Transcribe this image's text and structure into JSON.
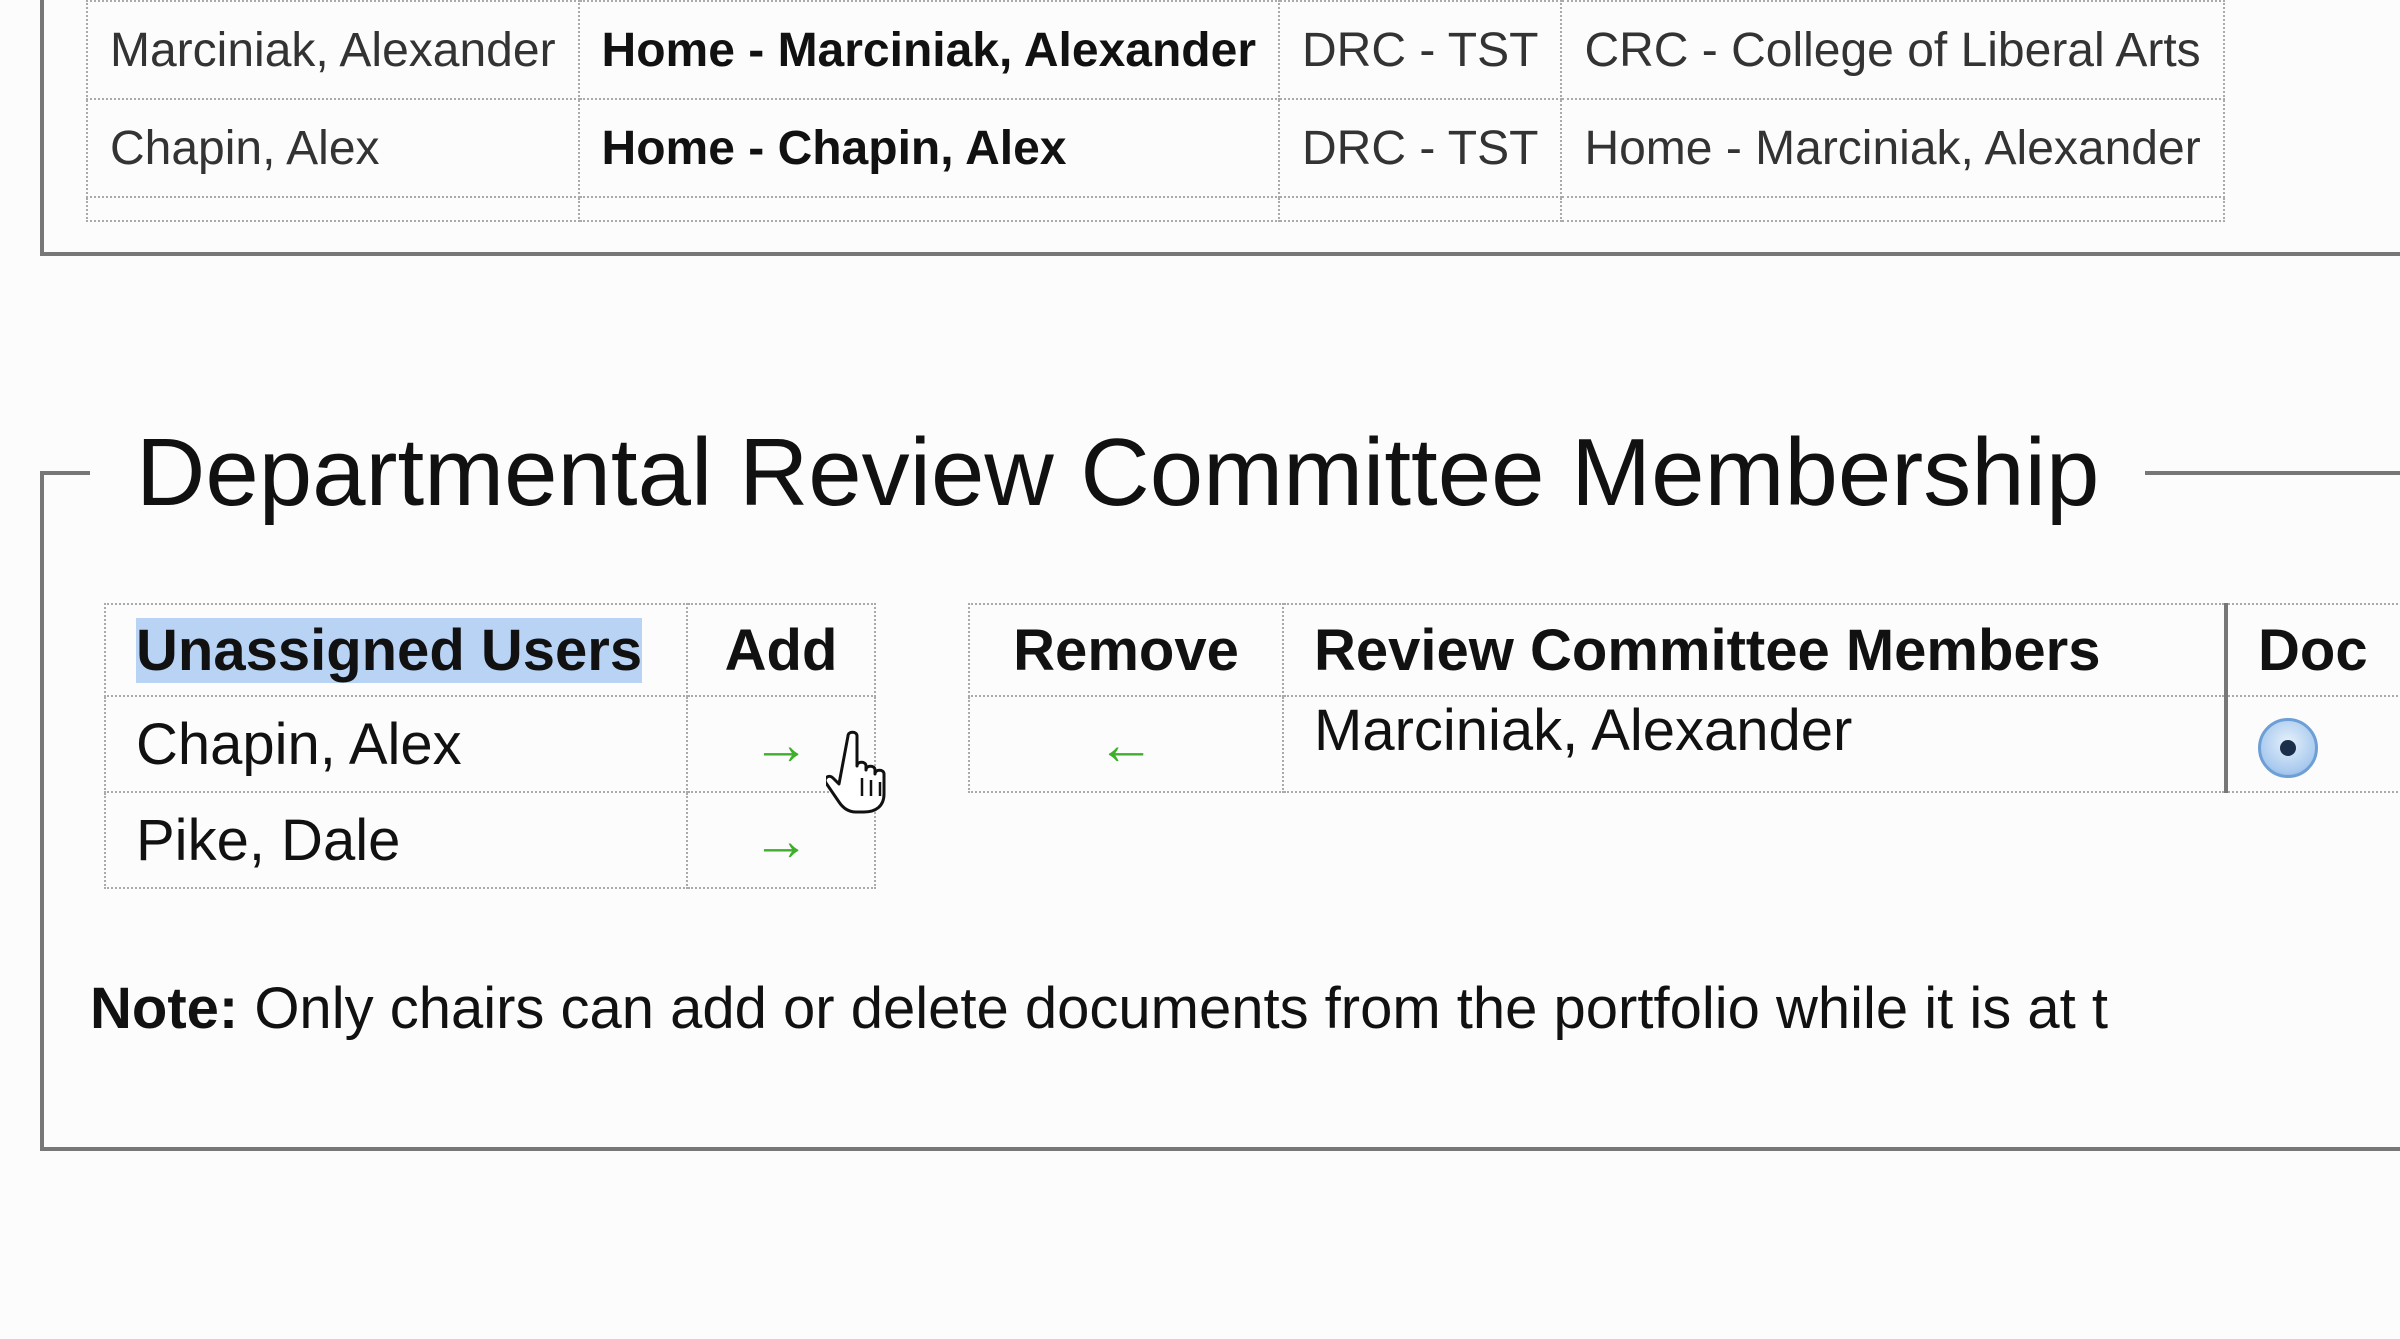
{
  "top_table": {
    "rows": [
      [
        "Marciniak, Alexander",
        "Home - Marciniak, Alexander",
        "DRC - TST",
        "CRC - College of Liberal Arts"
      ],
      [
        "Chapin, Alex",
        "Home - Chapin, Alex",
        "DRC - TST",
        "Home - Marciniak, Alexander"
      ]
    ]
  },
  "section": {
    "title": "Departmental Review Committee Membership"
  },
  "unassigned": {
    "header_users": "Unassigned Users",
    "header_add": "Add",
    "rows": [
      {
        "name": "Chapin, Alex",
        "add_icon": "arrow-right-icon"
      },
      {
        "name": "Pike, Dale",
        "add_icon": "arrow-right-icon"
      }
    ]
  },
  "members": {
    "header_remove": "Remove",
    "header_members": "Review Committee Members",
    "header_doc": "Doc",
    "rows": [
      {
        "name": "Marciniak, Alexander",
        "remove_icon": "arrow-left-icon"
      }
    ]
  },
  "note": {
    "label": "Note:",
    "text": " Only chairs can add or delete documents from the portfolio while it is at t"
  },
  "colors": {
    "arrow": "#3fae2d",
    "highlight": "#b9d3f5",
    "border": "#777777"
  }
}
